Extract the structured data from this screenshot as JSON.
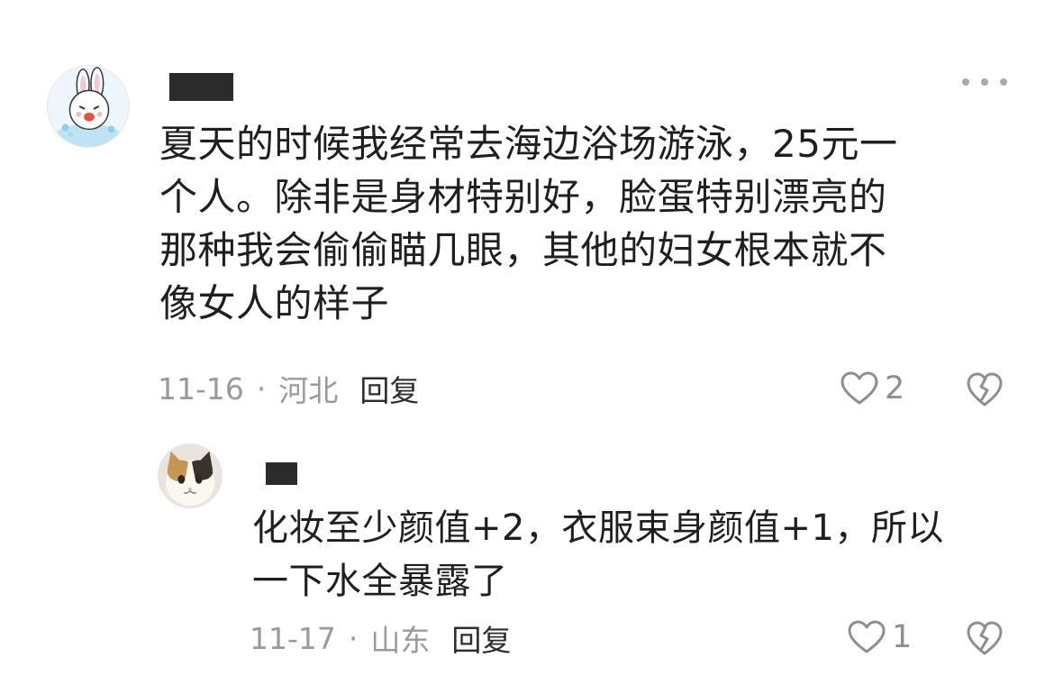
{
  "comments": [
    {
      "body": "夏天的时候我经常去海边浴场游泳，25元一\n个人。除非是身材特别好，脸蛋特别漂亮的\n那种我会偷偷瞄几眼，其他的妇女根本就不\n像女人的样子",
      "date": "11-16",
      "separator": "·",
      "location": "河北",
      "reply_label": "回复",
      "like_count": "2",
      "avatar_icon": "bunny-sticker-avatar"
    },
    {
      "body": "化妆至少颜值+2，衣服束身颜值+1，所以\n一下水全暴露了",
      "date": "11-17",
      "separator": "·",
      "location": "山东",
      "reply_label": "回复",
      "like_count": "1",
      "avatar_icon": "calico-cat-avatar"
    }
  ],
  "colors": {
    "text": "#1f1f1f",
    "meta": "#9a9a9a",
    "icon": "#8e8e8e",
    "redaction": "#2b2b2b"
  }
}
